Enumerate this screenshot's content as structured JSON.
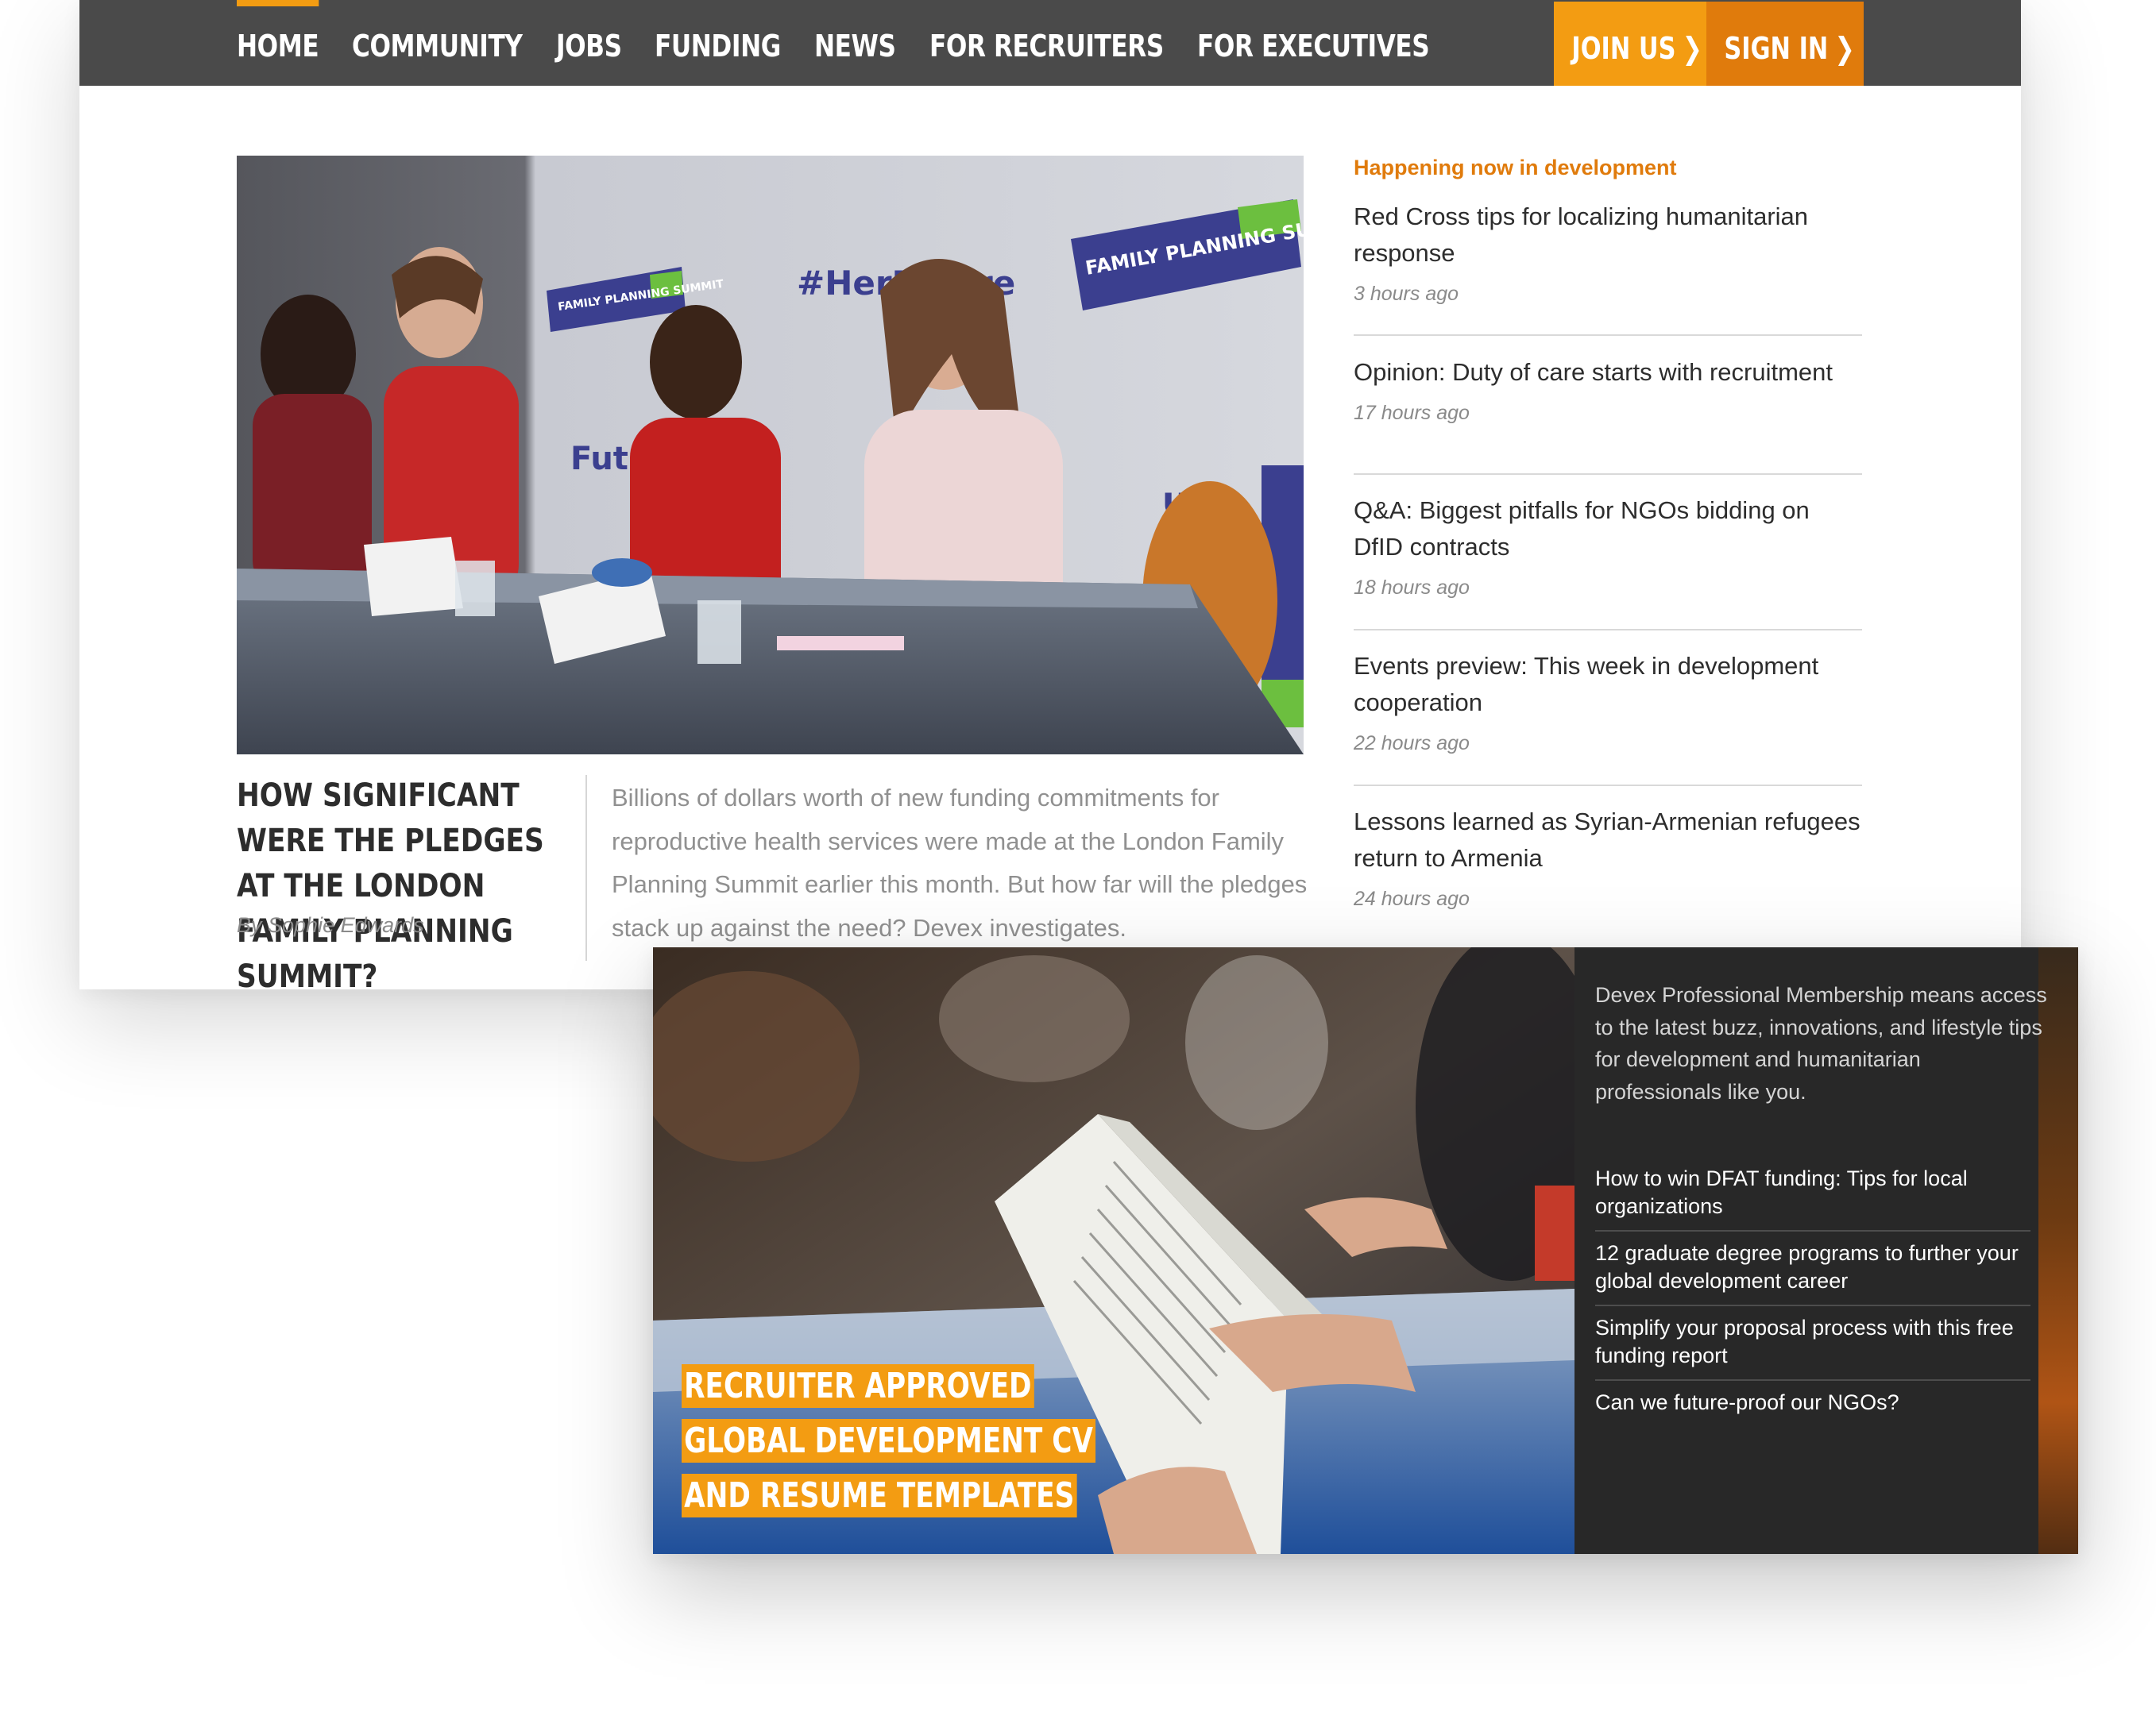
{
  "nav": {
    "items": [
      {
        "label": "HOME",
        "active": true
      },
      {
        "label": "COMMUNITY",
        "active": false
      },
      {
        "label": "JOBS",
        "active": false
      },
      {
        "label": "FUNDING",
        "active": false
      },
      {
        "label": "NEWS",
        "active": false
      },
      {
        "label": "FOR RECRUITERS",
        "active": false
      },
      {
        "label": "FOR EXECUTIVES",
        "active": false
      }
    ],
    "join_label": "JOIN US",
    "signin_label": "SIGN IN"
  },
  "featured": {
    "photo_alt": "panel at Family Planning Summit",
    "backdrop_texts": [
      "#HerFuture",
      "FAMILY PLANNING SUMMIT",
      "FAMILY PLANNING SUMMIT",
      "Future",
      "ure"
    ],
    "headline": "HOW SIGNIFICANT WERE THE PLEDGES AT THE LONDON FAMILY PLANNING SUMMIT?",
    "author": "By Sophie Edwards",
    "summary": "Billions of dollars worth of new funding commitments for reproductive health services were made at the London Family Planning Summit earlier this month. But how far will the pledges stack up against the need? Devex investigates."
  },
  "happening": {
    "title": "Happening now in development",
    "items": [
      {
        "title": "Red Cross tips for localizing humanitarian response",
        "time": "3 hours ago"
      },
      {
        "title": "Opinion: Duty of care starts with recruitment",
        "time": "17 hours ago"
      },
      {
        "title": "Q&A: Biggest pitfalls for NGOs bidding on DfID contracts",
        "time": "18 hours ago"
      },
      {
        "title": "Events preview: This week in development cooperation",
        "time": "22 hours ago"
      },
      {
        "title": "Lessons learned as Syrian-Armenian refugees return to Armenia",
        "time": "24 hours ago"
      }
    ]
  },
  "promo": {
    "headline": "RECRUITER APPROVED GLOBAL DEVELOPMENT CV AND RESUME TEMPLATES",
    "description": "Devex Professional Membership means access to the latest buzz, innovations, and lifestyle tips for development and humanitarian professionals like you.",
    "links": [
      "How to win DFAT funding: Tips for local organizations",
      "12 graduate degree programs to further your global development career",
      "Simplify your proposal process with this free funding report",
      "Can we future-proof our NGOs?"
    ]
  },
  "colors": {
    "nav_bg": "#4a4a4a",
    "accent_orange": "#f39c12",
    "accent_dark_orange": "#e07b0c",
    "panel_dark": "#282828"
  }
}
